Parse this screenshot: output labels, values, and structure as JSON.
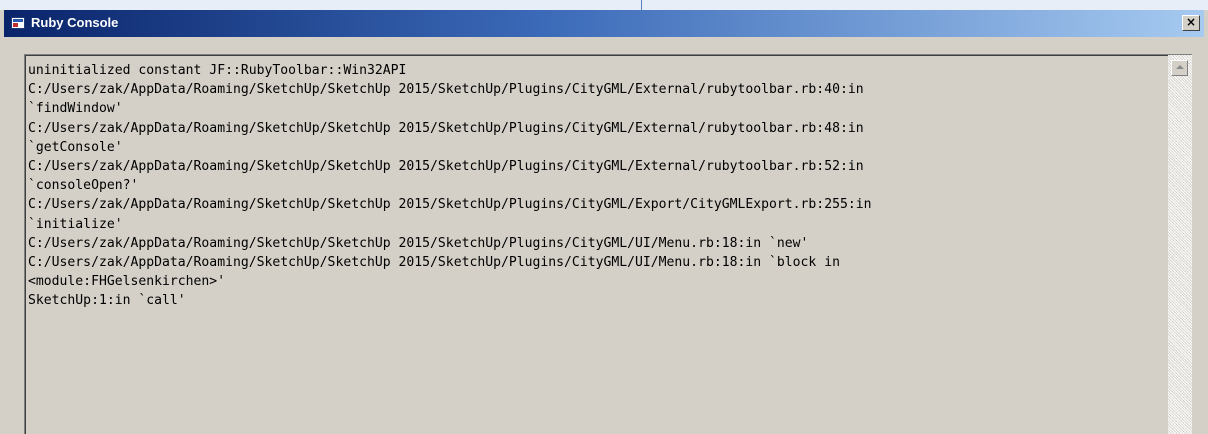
{
  "window": {
    "title": "Ruby Console",
    "close_label": "×"
  },
  "icons": {
    "window": "ruby-console-icon",
    "close": "close-icon",
    "scroll_up": "arrow-up-icon"
  },
  "colors": {
    "titlebar_start": "#0a246a",
    "titlebar_end": "#a6caf0",
    "window_bg": "#d4d0c8"
  },
  "console": {
    "lines": [
      "uninitialized constant JF::RubyToolbar::Win32API",
      "C:/Users/zak/AppData/Roaming/SketchUp/SketchUp 2015/SketchUp/Plugins/CityGML/External/rubytoolbar.rb:40:in",
      "`findWindow'",
      "C:/Users/zak/AppData/Roaming/SketchUp/SketchUp 2015/SketchUp/Plugins/CityGML/External/rubytoolbar.rb:48:in",
      "`getConsole'",
      "C:/Users/zak/AppData/Roaming/SketchUp/SketchUp 2015/SketchUp/Plugins/CityGML/External/rubytoolbar.rb:52:in",
      "`consoleOpen?'",
      "C:/Users/zak/AppData/Roaming/SketchUp/SketchUp 2015/SketchUp/Plugins/CityGML/Export/CityGMLExport.rb:255:in",
      "`initialize'",
      "C:/Users/zak/AppData/Roaming/SketchUp/SketchUp 2015/SketchUp/Plugins/CityGML/UI/Menu.rb:18:in `new'",
      "C:/Users/zak/AppData/Roaming/SketchUp/SketchUp 2015/SketchUp/Plugins/CityGML/UI/Menu.rb:18:in `block in",
      "<module:FHGelsenkirchen>'",
      "SketchUp:1:in `call'"
    ]
  }
}
